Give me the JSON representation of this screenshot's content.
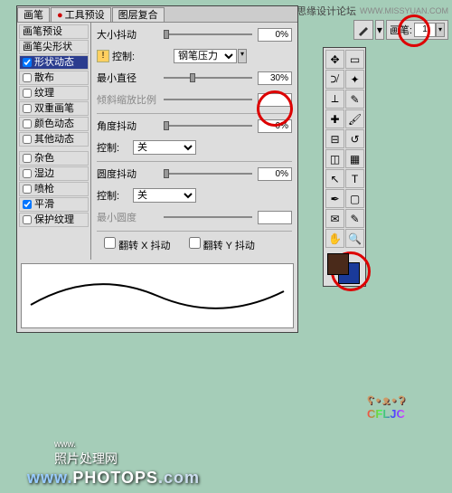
{
  "header": {
    "site_label": "思缘设计论坛",
    "site_url": "WWW.MISSYUAN.COM"
  },
  "top_toolbar": {
    "brush_label": "画笔:",
    "brush_size": "1"
  },
  "tabs": [
    "画笔",
    "工具预设",
    "图层复合"
  ],
  "side": {
    "preset": "画笔预设",
    "tip": "画笔尖形状",
    "items": [
      {
        "label": "形状动态",
        "checked": true,
        "selected": true
      },
      {
        "label": "散布",
        "checked": false
      },
      {
        "label": "纹理",
        "checked": false
      },
      {
        "label": "双重画笔",
        "checked": false
      },
      {
        "label": "颜色动态",
        "checked": false
      },
      {
        "label": "其他动态",
        "checked": false
      }
    ],
    "extras": [
      {
        "label": "杂色",
        "checked": false
      },
      {
        "label": "湿边",
        "checked": false
      },
      {
        "label": "喷枪",
        "checked": false
      },
      {
        "label": "平滑",
        "checked": true
      },
      {
        "label": "保护纹理",
        "checked": false
      }
    ]
  },
  "settings": {
    "size_jitter": {
      "label": "大小抖动",
      "value": "0%"
    },
    "control1": {
      "label": "控制:",
      "value": "钢笔压力"
    },
    "min_diameter": {
      "label": "最小直径",
      "value": "30%"
    },
    "tilt_scale": {
      "label": "倾斜缩放比例"
    },
    "angle_jitter": {
      "label": "角度抖动",
      "value": "0%"
    },
    "control2": {
      "label": "控制:",
      "value": "关"
    },
    "roundness_jitter": {
      "label": "圆度抖动",
      "value": "0%"
    },
    "control3": {
      "label": "控制:",
      "value": "关"
    },
    "min_roundness": {
      "label": "最小圆度"
    },
    "flip_x": "翻转 X 抖动",
    "flip_y": "翻转 Y 抖动"
  },
  "watermark": {
    "logo1": "ʕ•ᴥ•ʔ",
    "logo2": "CFLJC"
  },
  "bottom": {
    "line1": "照片处理网",
    "line2": "www.",
    "photops": "PHOTOPS",
    "dot": ".com"
  }
}
